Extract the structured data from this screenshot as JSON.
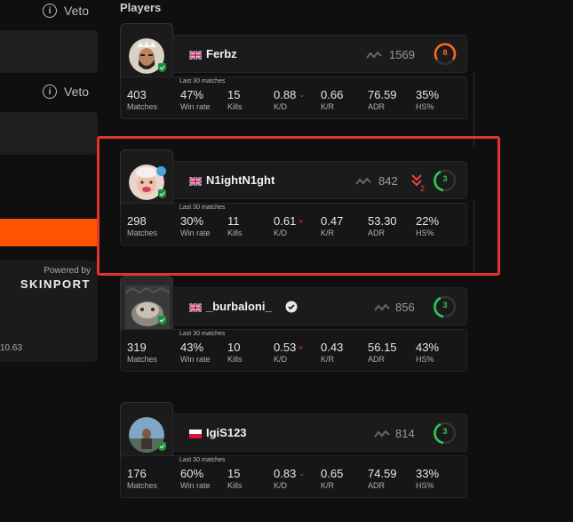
{
  "left_panel": {
    "veto_1": "Veto",
    "veto_2": "Veto",
    "sponsor_powered": "Powered by",
    "sponsor_name": "SKINPORT",
    "sponsor_value": "10.63"
  },
  "section_title": "Players",
  "stats_caption": "Last 30 matches",
  "stat_labels": {
    "matches": "Matches",
    "winrate": "Win rate",
    "kills": "Kills",
    "kd": "K/D",
    "kr": "K/R",
    "adr": "ADR",
    "hs": "HS%"
  },
  "players": [
    {
      "name": "Ferbz",
      "flag": "uk",
      "elo": "1569",
      "level": "8",
      "level_color": "#ff6a1f",
      "matches": "403",
      "winrate": "47%",
      "kills": "15",
      "kd": "0.88",
      "kr": "0.66",
      "adr": "76.59",
      "hs": "35%"
    },
    {
      "name": "N1ightN1ght",
      "flag": "uk",
      "elo": "842",
      "level": "3",
      "level_color": "#2ecc55",
      "elo_change": "2",
      "matches": "298",
      "winrate": "30%",
      "kills": "11",
      "kd": "0.61",
      "kr": "0.47",
      "adr": "53.30",
      "hs": "22%"
    },
    {
      "name": "_burbaloni_",
      "flag": "uk",
      "elo": "856",
      "level": "3",
      "level_color": "#2ecc55",
      "matches": "319",
      "winrate": "43%",
      "kills": "10",
      "kd": "0.53",
      "kr": "0.43",
      "adr": "56.15",
      "hs": "43%"
    },
    {
      "name": "IgiS123",
      "flag": "pl",
      "elo": "814",
      "level": "3",
      "level_color": "#2ecc55",
      "matches": "176",
      "winrate": "60%",
      "kills": "15",
      "kd": "0.83",
      "kr": "0.65",
      "adr": "74.59",
      "hs": "33%"
    }
  ],
  "colors": {
    "accent": "#ff5500",
    "highlight": "#e0342f",
    "down": "#e44444"
  }
}
